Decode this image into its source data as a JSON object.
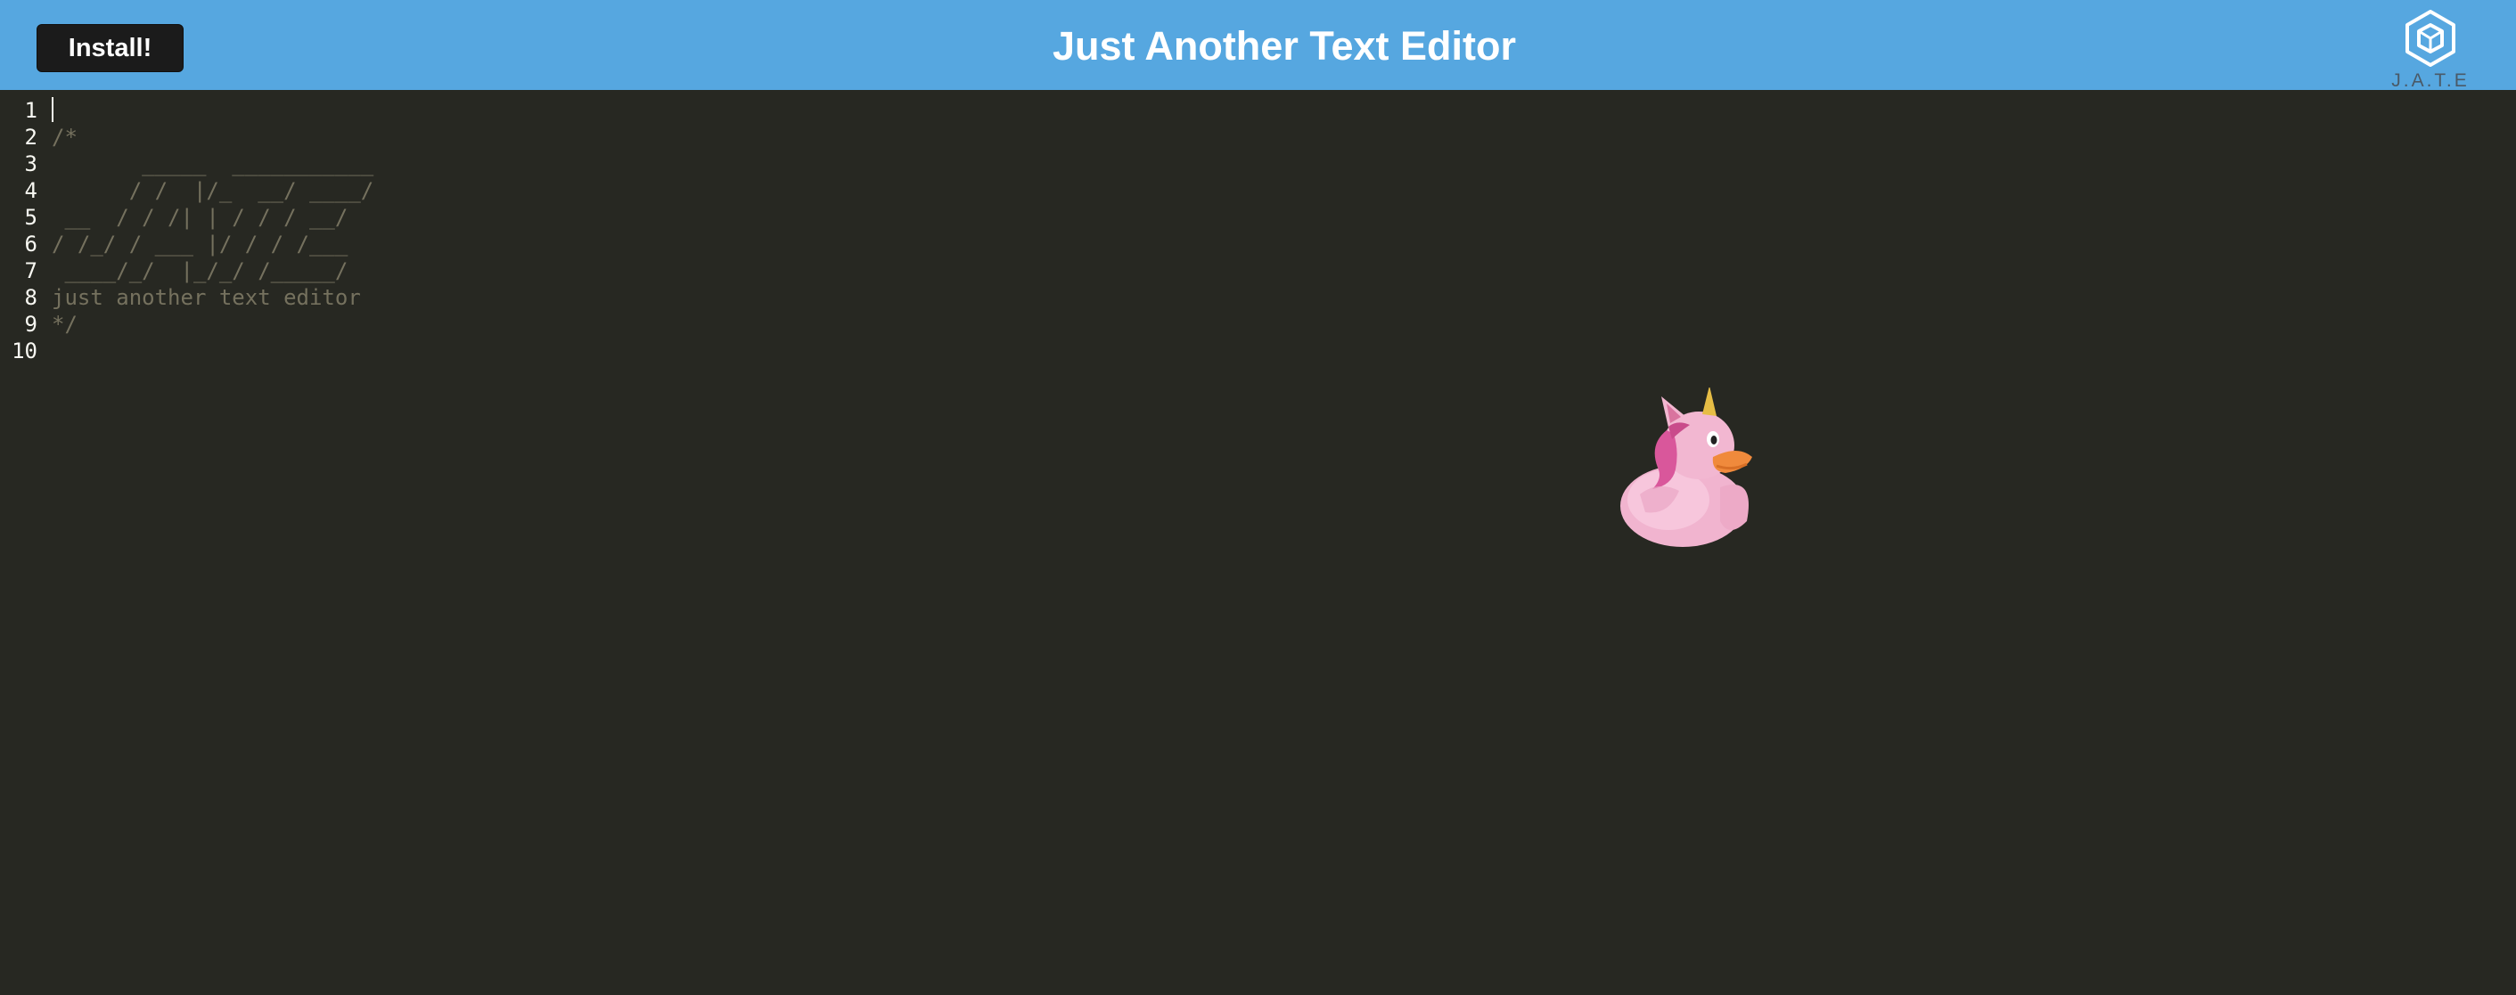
{
  "header": {
    "install_label": "Install!",
    "title": "Just Another Text Editor",
    "logo_text": "J.A.T.E"
  },
  "editor": {
    "line_numbers": [
      "1",
      "2",
      "3",
      "4",
      "5",
      "6",
      "7",
      "8",
      "9",
      "10"
    ],
    "lines": [
      "",
      "/*",
      "       _____  ___________",
      "      / /  |/_  __/ ____/",
      " __  / / /| | / / / __/",
      "/ /_/ / ___ |/ / / /___",
      " ____/_/  |_/_/ /_____/",
      "just another text editor",
      "*/",
      ""
    ]
  },
  "colors": {
    "header_bg": "#56a7e0",
    "editor_bg": "#272822",
    "comment": "#75715e",
    "line_number": "#f8f8f2"
  }
}
